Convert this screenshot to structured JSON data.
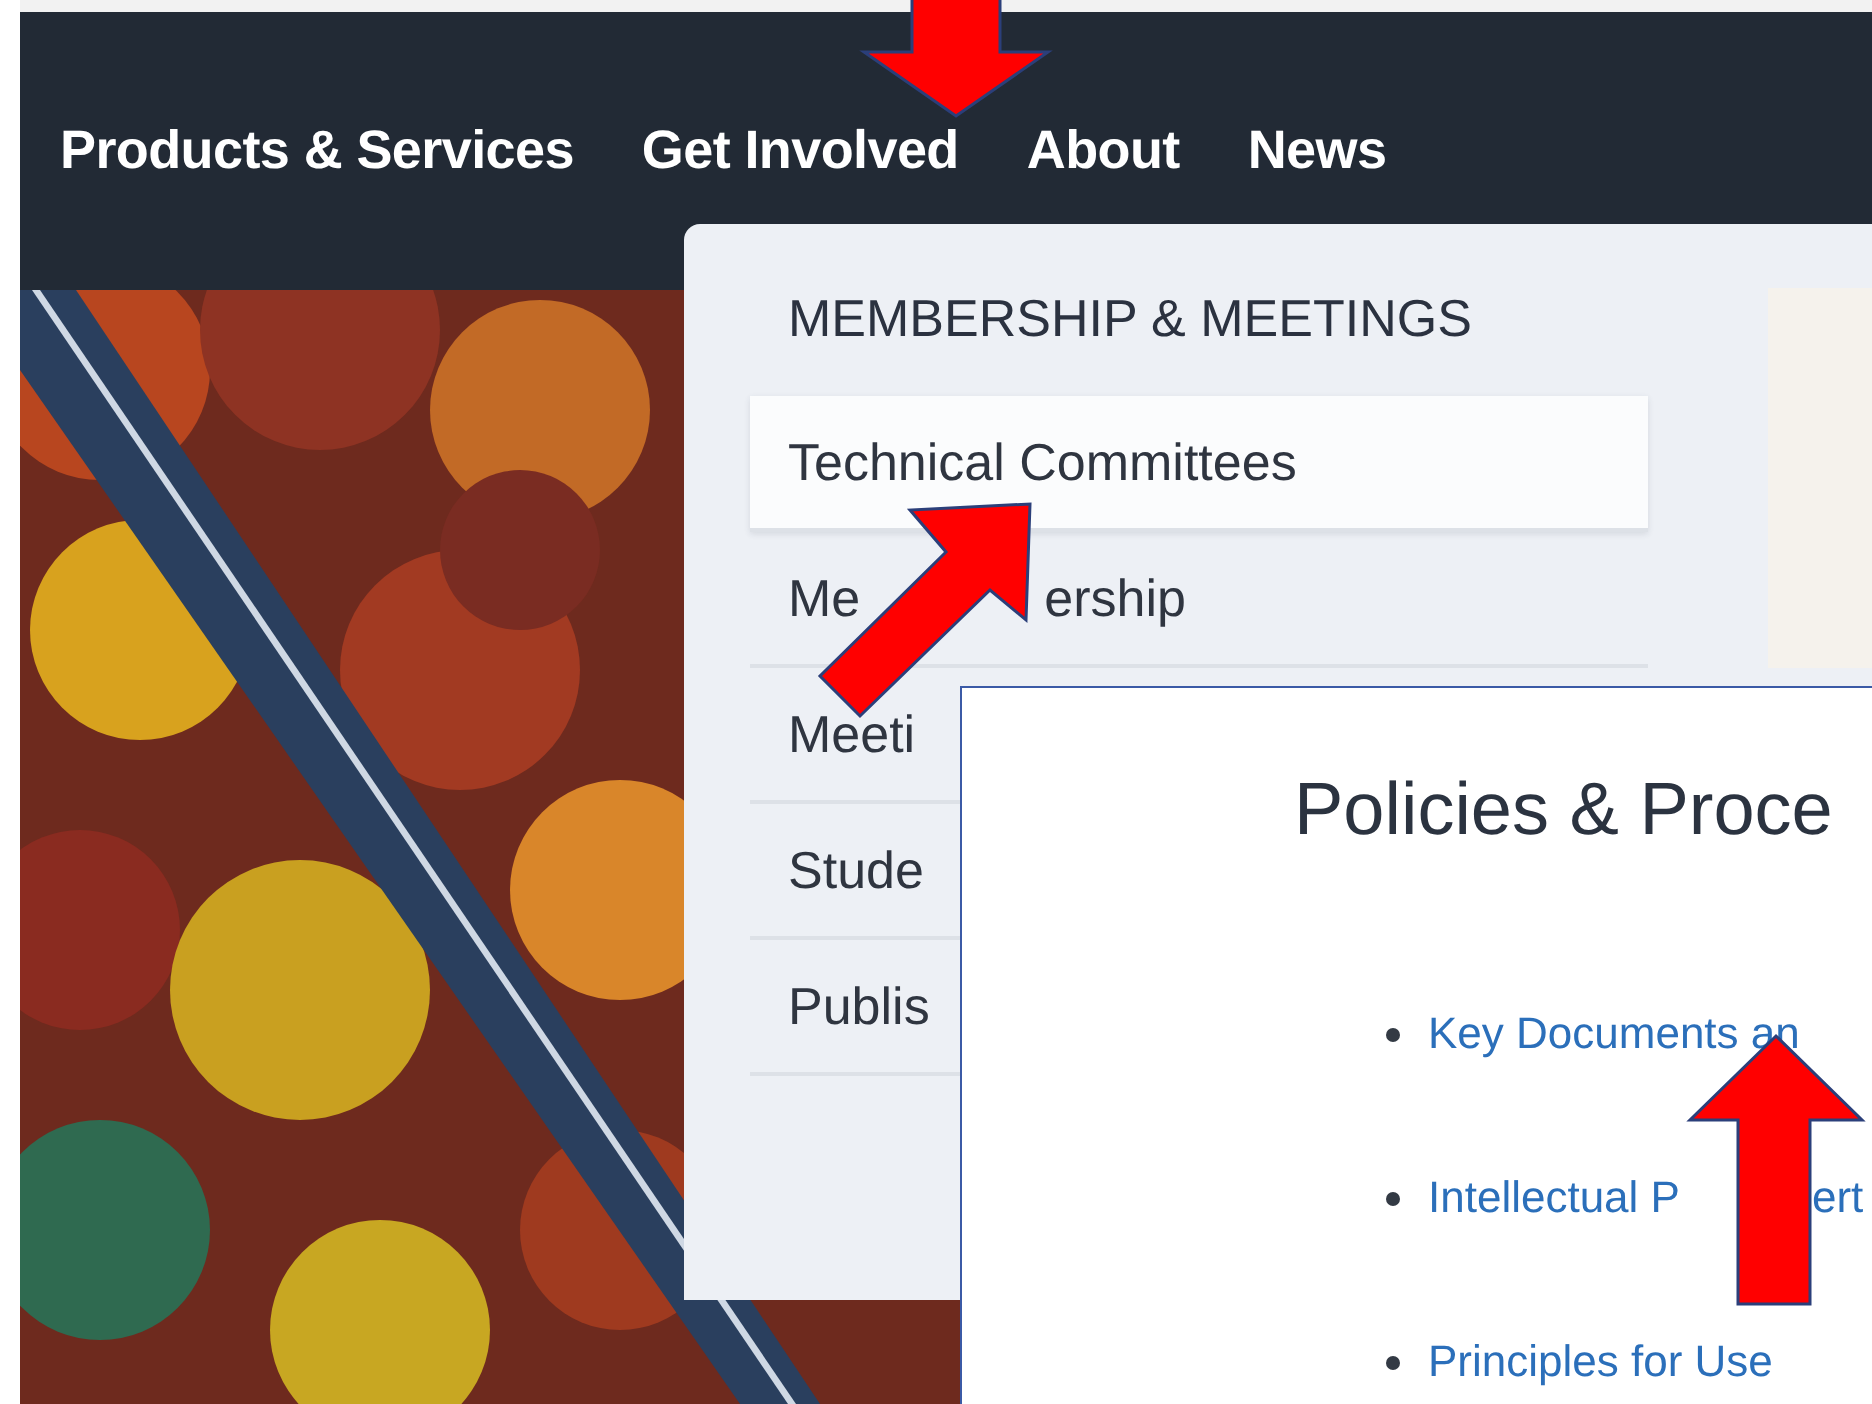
{
  "nav": {
    "items": [
      {
        "label": "Products & Services"
      },
      {
        "label": "Get Involved"
      },
      {
        "label": "About"
      },
      {
        "label": "News"
      }
    ]
  },
  "dropdown": {
    "heading": "MEMBERSHIP & MEETINGS",
    "items": [
      {
        "label": "Technical Committees",
        "selected": true
      },
      {
        "label": "Me",
        "label_end": "ership",
        "selected": false
      },
      {
        "label": "Meeti",
        "selected": false
      },
      {
        "label": "Stude",
        "selected": false
      },
      {
        "label": "Publis",
        "selected": false
      }
    ]
  },
  "inset": {
    "title": "Policies & Proce",
    "links": [
      {
        "label": "Key Documents an"
      },
      {
        "label": "Intellectual P",
        "label_end": "ert"
      },
      {
        "label": "Principles for Use"
      }
    ]
  }
}
